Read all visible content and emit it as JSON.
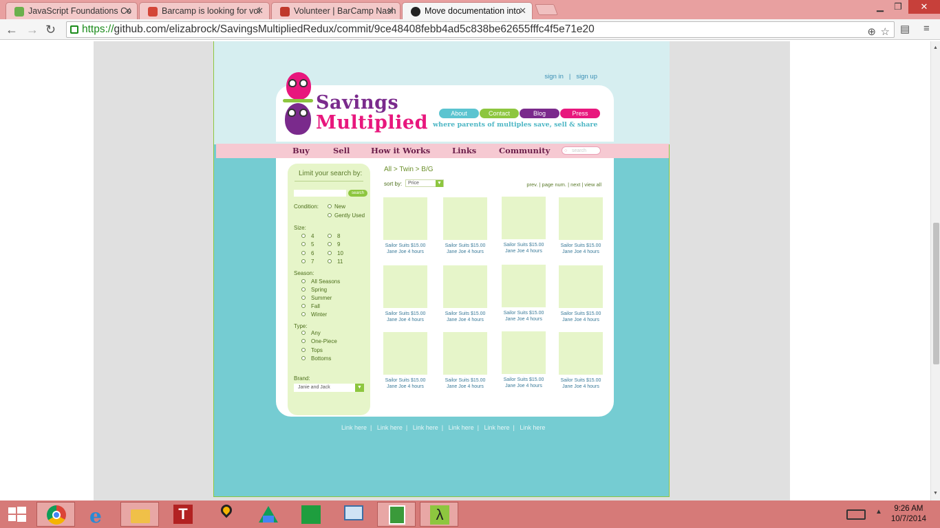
{
  "browser": {
    "tabs": [
      {
        "title": "JavaScript Foundations Co",
        "favicon_color": "#6ab04c"
      },
      {
        "title": "Barcamp is looking for vol",
        "favicon_color": "#d44638"
      },
      {
        "title": "Volunteer | BarCamp Nash",
        "favicon_color": "#c0392b"
      },
      {
        "title": "Move documentation into",
        "favicon_color": "#222222",
        "active": true
      }
    ],
    "url_scheme": "https://",
    "url_rest": "github.com/elizabrock/SavingsMultipliedRedux/commit/9ce48408febb4ad5c838be62655fffc4f5e71e20"
  },
  "site": {
    "auth_links": [
      "sign in",
      "|",
      "sign up"
    ],
    "brand_line1": "Savings",
    "brand_line2": "Multiplied",
    "tagline": "where parents of multiples save, sell & share",
    "pills": [
      {
        "label": "About",
        "color": "#5bc4d0"
      },
      {
        "label": "Contact",
        "color": "#8dc63f"
      },
      {
        "label": "Blog",
        "color": "#7a2a8c"
      },
      {
        "label": "Press",
        "color": "#e8177d"
      }
    ],
    "nav": [
      "Buy",
      "Sell",
      "How it Works",
      "Links",
      "Community"
    ],
    "nav_search_placeholder": "search",
    "filter": {
      "title": "Limit your search by:",
      "search_button": "search",
      "condition_label": "Condition:",
      "condition_options": [
        "New",
        "Gently Used"
      ],
      "size_label": "Size:",
      "sizes_left": [
        "4",
        "5",
        "6",
        "7"
      ],
      "sizes_right": [
        "8",
        "9",
        "10",
        "11"
      ],
      "season_label": "Season:",
      "seasons": [
        "All Seasons",
        "Spring",
        "Summer",
        "Fall",
        "Winter"
      ],
      "type_label": "Type:",
      "types": [
        "Any",
        "One-Piece",
        "Tops",
        "Bottoms"
      ],
      "brand_label": "Brand:",
      "brand_value": "Janie and Jack"
    },
    "breadcrumb": "All > Twin > B/G",
    "sort_label": "sort by:",
    "sort_value": "Price",
    "pager": "prev.  |  page num.  |  next  |  view all",
    "product": {
      "line1": "Sailor Suits  $15.00",
      "line2": "Jane Joe   4 hours"
    },
    "footer_links": [
      "Link here",
      "Link here",
      "Link here",
      "Link here",
      "Link here",
      "Link here"
    ]
  },
  "taskbar": {
    "time": "9:26 AM",
    "date": "10/7/2014"
  }
}
